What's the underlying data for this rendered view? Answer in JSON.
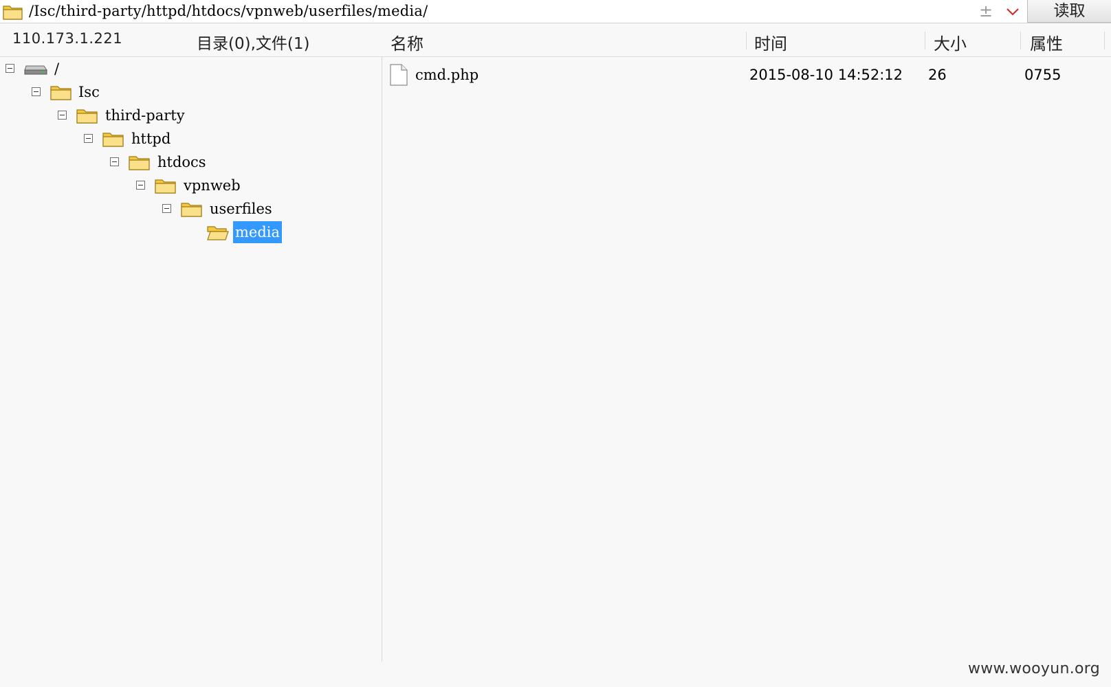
{
  "address_bar": {
    "path": "/Isc/third-party/httpd/htdocs/vpnweb/userfiles/media/",
    "plus_glyph": "±",
    "read_button_label": "读取"
  },
  "status": {
    "host_ip": "110.173.1.221",
    "counts": "目录(0),文件(1)"
  },
  "columns": {
    "name": "名称",
    "time": "时间",
    "size": "大小",
    "attributes": "属性"
  },
  "tree": {
    "nodes": [
      {
        "label": "/",
        "icon": "drive-icon",
        "expanded": true
      },
      {
        "label": "Isc",
        "icon": "folder-icon",
        "expanded": true
      },
      {
        "label": "third-party",
        "icon": "folder-icon",
        "expanded": true
      },
      {
        "label": "httpd",
        "icon": "folder-icon",
        "expanded": true
      },
      {
        "label": "htdocs",
        "icon": "folder-icon",
        "expanded": true
      },
      {
        "label": "vpnweb",
        "icon": "folder-icon",
        "expanded": true
      },
      {
        "label": "userfiles",
        "icon": "folder-icon",
        "expanded": true
      },
      {
        "label": "media",
        "icon": "open-folder-icon",
        "selected": true
      }
    ]
  },
  "files": [
    {
      "name": "cmd.php",
      "time": "2015-08-10 14:52:12",
      "size": "26",
      "attributes": "0755",
      "icon": "file-icon"
    }
  ],
  "watermark": "www.wooyun.org",
  "colors": {
    "selection": "#3399ff",
    "folder_yellow": "#f5c842",
    "dropdown_red": "#e02020"
  }
}
